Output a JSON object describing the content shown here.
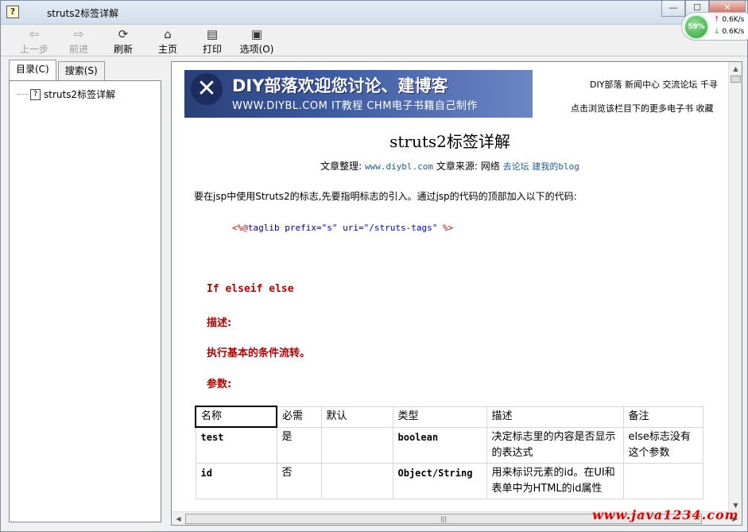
{
  "window": {
    "title": "struts2标签详解",
    "controls": [
      "—",
      "☐",
      "✕"
    ]
  },
  "net_widget": {
    "percent": "59%",
    "up": "0.6K/s",
    "down": "0.6K/s"
  },
  "toolbar": {
    "back": "上一步",
    "forward": "前进",
    "refresh": "刷新",
    "home": "主页",
    "print": "打印",
    "options": "选项(O)"
  },
  "nav_tabs": {
    "contents": "目录(C)",
    "search": "搜索(S)"
  },
  "tree": {
    "items": [
      {
        "label": "struts2标签详解"
      }
    ]
  },
  "page": {
    "banner": {
      "line1": "DIY部落欢迎您讨论、建博客",
      "line2": "WWW.DIYBL.COM IT教程 CHM电子书籍自己制作"
    },
    "top_links": [
      "DIY部落",
      "新闻中心",
      "交流论坛",
      "千寻"
    ],
    "sub_links": [
      "点击浏览该栏目下的更多电子书",
      "收藏"
    ],
    "title": "struts2标签详解",
    "meta": {
      "compiled_label": "文章整理:",
      "compiled_link": "www.diybl.com",
      "source_label": "文章来源:",
      "source_value": "网络",
      "forum_link": "去论坛",
      "blog_link": "建我的blog"
    },
    "intro": "要在jsp中使用Struts2的标志,先要指明标志的引入。通过jsp的代码的顶部加入以下的代码:",
    "code": {
      "open": "<%@",
      "directive": "taglib",
      "attr1": "prefix=",
      "val1": "\"s\"",
      "attr2": "uri=",
      "val2": "\"/struts-tags\"",
      "close": "%>"
    },
    "section_heading": "If elseif  else",
    "desc_label": "描述:",
    "desc_text": "执行基本的条件流转。",
    "params_label": "参数:",
    "table": {
      "headers": [
        "名称",
        "必需",
        "默认",
        "类型",
        "描述",
        "备注"
      ],
      "rows": [
        [
          "test",
          "是",
          "",
          "boolean",
          "决定标志里的内容是否显示的表达式",
          "else标志没有这个参数"
        ],
        [
          "id",
          "否",
          "",
          "Object/String",
          "用来标识元素的id。在UI和表单中为HTML的id属性",
          ""
        ]
      ]
    }
  },
  "watermark": "www.java1234.com"
}
